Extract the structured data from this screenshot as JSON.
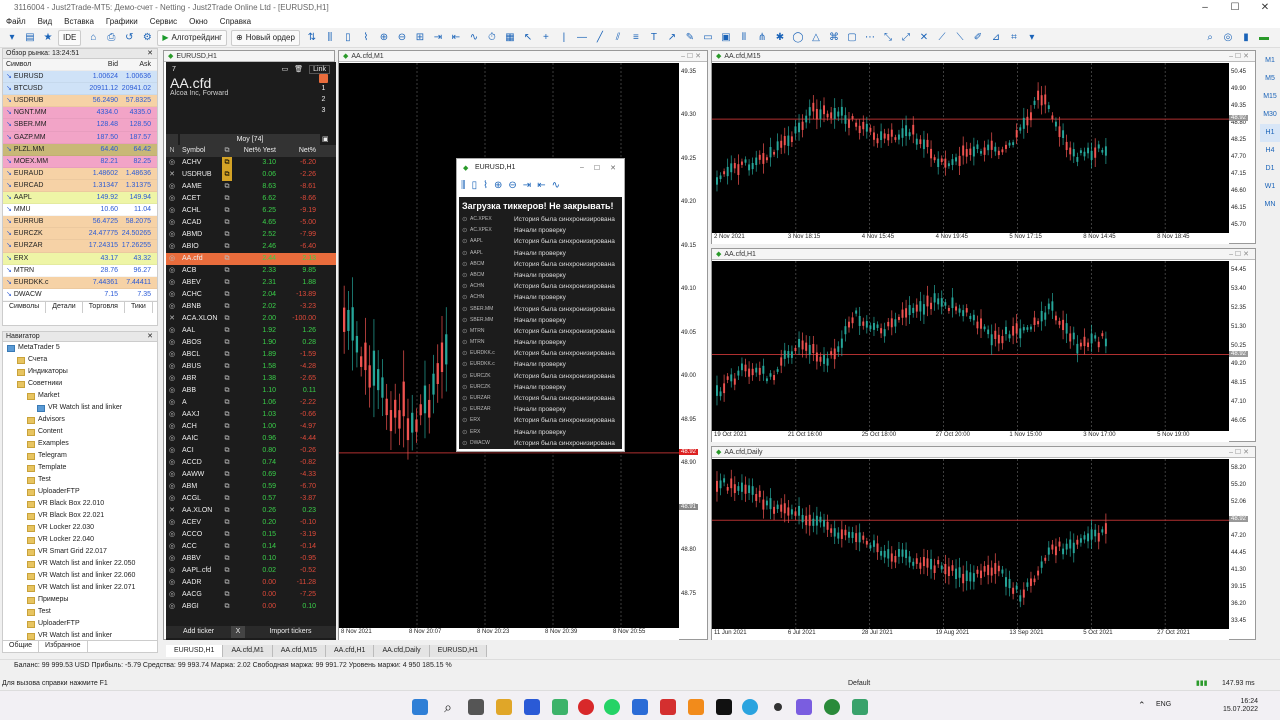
{
  "window": {
    "title": "3116004 - Just2Trade-MT5: Демо-счет - Netting - Just2Trade Online Ltd - [EURUSD,H1]"
  },
  "menu": [
    "Файл",
    "Вид",
    "Вставка",
    "Графики",
    "Сервис",
    "Окно",
    "Справка"
  ],
  "toolbar": {
    "algo": "Алготрейдинг",
    "new_order": "Новый ордер",
    "ide": "IDE"
  },
  "market_watch": {
    "title": "Обзор рынка: 13:24:51",
    "col_symbol": "Символ",
    "col_bid": "Bid",
    "col_ask": "Ask",
    "rows": [
      {
        "s": "EURUSD",
        "b": "1.00624",
        "a": "1.00636",
        "bg": "#cfe2f7"
      },
      {
        "s": "BTCUSD",
        "b": "20911.12",
        "a": "20941.02",
        "bg": "#cfe2f7"
      },
      {
        "s": "USDRUB",
        "b": "56.2490",
        "a": "57.8325",
        "bg": "#f6d2a6"
      },
      {
        "s": "NGNT.MM",
        "b": "4334.0",
        "a": "4335.0",
        "bg": "#f2a4c7"
      },
      {
        "s": "SBER.MM",
        "b": "128.48",
        "a": "128.50",
        "bg": "#f2a4c7"
      },
      {
        "s": "GAZP.MM",
        "b": "187.50",
        "a": "187.57",
        "bg": "#f2a4c7"
      },
      {
        "s": "PLZL.MM",
        "b": "64.40",
        "a": "64.42",
        "bg": "#c8b877"
      },
      {
        "s": "MOEX.MM",
        "b": "82.21",
        "a": "82.25",
        "bg": "#f2a4c7"
      },
      {
        "s": "EURAUD",
        "b": "1.48602",
        "a": "1.48636",
        "bg": "#f6d2a6"
      },
      {
        "s": "EURCAD",
        "b": "1.31347",
        "a": "1.31375",
        "bg": "#f6d2a6"
      },
      {
        "s": "AAPL",
        "b": "149.92",
        "a": "149.94",
        "bg": "#eef5a6"
      },
      {
        "s": "MMU",
        "b": "10.60",
        "a": "11.04",
        "bg": "#ffffff"
      },
      {
        "s": "EURRUB",
        "b": "56.4725",
        "a": "58.2075",
        "bg": "#f6d2a6"
      },
      {
        "s": "EURCZK",
        "b": "24.47775",
        "a": "24.50265",
        "bg": "#f6d2a6"
      },
      {
        "s": "EURZAR",
        "b": "17.24315",
        "a": "17.26255",
        "bg": "#f6d2a6"
      },
      {
        "s": "ERX",
        "b": "43.17",
        "a": "43.32",
        "bg": "#eef5a6"
      },
      {
        "s": "MTRN",
        "b": "28.76",
        "a": "96.27",
        "bg": "#ffffff"
      },
      {
        "s": "EURDKK.c",
        "b": "7.44361",
        "a": "7.44411",
        "bg": "#f6d2a6"
      },
      {
        "s": "DWACW",
        "b": "7.15",
        "a": "7.35",
        "bg": "#ffffff"
      }
    ],
    "tabs": [
      "Символы",
      "Детали",
      "Торговля",
      "Тики"
    ]
  },
  "navigator": {
    "title": "Навигатор",
    "items": [
      {
        "t": "MetaTrader 5",
        "l": 0
      },
      {
        "t": "Счета",
        "l": 1
      },
      {
        "t": "Индикаторы",
        "l": 1
      },
      {
        "t": "Советники",
        "l": 1
      },
      {
        "t": "Market",
        "l": 2
      },
      {
        "t": "VR Watch list and linker",
        "l": 3
      },
      {
        "t": "Advisors",
        "l": 2
      },
      {
        "t": "Content",
        "l": 2
      },
      {
        "t": "Examples",
        "l": 2
      },
      {
        "t": "Telegram",
        "l": 2
      },
      {
        "t": "Template",
        "l": 2
      },
      {
        "t": "Test",
        "l": 2
      },
      {
        "t": "UploaderFTP",
        "l": 2
      },
      {
        "t": "VR Black Box 22.010",
        "l": 2
      },
      {
        "t": "VR Black Box 22.021",
        "l": 2
      },
      {
        "t": "VR Locker 22.030",
        "l": 2
      },
      {
        "t": "VR Locker 22.040",
        "l": 2
      },
      {
        "t": "VR Smart Grid 22.017",
        "l": 2
      },
      {
        "t": "VR Watch list and linker 22.050",
        "l": 2
      },
      {
        "t": "VR Watch list and linker 22.060",
        "l": 2
      },
      {
        "t": "VR Watch list and linker 22.071",
        "l": 2
      },
      {
        "t": "Примеры",
        "l": 2
      },
      {
        "t": "Test",
        "l": 2
      },
      {
        "t": "UploaderFTP",
        "l": 2
      },
      {
        "t": "VR Watch list and linker",
        "l": 2
      }
    ],
    "tabs": [
      "Общие",
      "Избранное"
    ]
  },
  "eurusd_window": {
    "title": "EURUSD,H1"
  },
  "watchlist": {
    "num": "7",
    "symbol": "AA.cfd",
    "company": "Alcoa Inc, Forward",
    "link": "Link",
    "group": "Moy [74]",
    "col_symbol": "Symbol",
    "col_yest": "Net% Yest",
    "col_net": "Net%",
    "n_label": "N",
    "list_numbers": [
      "1",
      "2",
      "3"
    ],
    "rows": [
      {
        "s": "ACHV",
        "y": "3.10",
        "n": "-6.20"
      },
      {
        "s": "USDRUB",
        "y": "0.06",
        "n": "-2.26"
      },
      {
        "s": "AAME",
        "y": "8.63",
        "n": "-8.61"
      },
      {
        "s": "ACET",
        "y": "6.62",
        "n": "-8.66"
      },
      {
        "s": "ACHL",
        "y": "6.25",
        "n": "-9.19"
      },
      {
        "s": "ACAD",
        "y": "4.65",
        "n": "-5.00"
      },
      {
        "s": "ABMD",
        "y": "2.52",
        "n": "-7.99"
      },
      {
        "s": "ABIO",
        "y": "2.46",
        "n": "-6.40"
      },
      {
        "s": "AA.cfd",
        "y": "2.44",
        "n": "2.13",
        "sel": true
      },
      {
        "s": "ACB",
        "y": "2.33",
        "n": "9.85"
      },
      {
        "s": "ABEV",
        "y": "2.31",
        "n": "1.88"
      },
      {
        "s": "ACHC",
        "y": "2.04",
        "n": "-13.89"
      },
      {
        "s": "ABNB",
        "y": "2.02",
        "n": "-3.23"
      },
      {
        "s": "ACA.XLON",
        "y": "2.00",
        "n": "-100.00"
      },
      {
        "s": "AAL",
        "y": "1.92",
        "n": "1.26"
      },
      {
        "s": "ABOS",
        "y": "1.90",
        "n": "0.28"
      },
      {
        "s": "ABCL",
        "y": "1.89",
        "n": "-1.59"
      },
      {
        "s": "ABUS",
        "y": "1.58",
        "n": "-4.28"
      },
      {
        "s": "ABR",
        "y": "1.38",
        "n": "-2.65"
      },
      {
        "s": "ABB",
        "y": "1.10",
        "n": "0.11"
      },
      {
        "s": "A",
        "y": "1.06",
        "n": "-2.22"
      },
      {
        "s": "AAXJ",
        "y": "1.03",
        "n": "-0.66"
      },
      {
        "s": "ACH",
        "y": "1.00",
        "n": "-4.97"
      },
      {
        "s": "AAIC",
        "y": "0.96",
        "n": "-4.44"
      },
      {
        "s": "ACI",
        "y": "0.80",
        "n": "-0.26"
      },
      {
        "s": "ACCD",
        "y": "0.74",
        "n": "-0.82"
      },
      {
        "s": "AAWW",
        "y": "0.69",
        "n": "-4.33"
      },
      {
        "s": "ABM",
        "y": "0.59",
        "n": "-6.70"
      },
      {
        "s": "ACGL",
        "y": "0.57",
        "n": "-3.87"
      },
      {
        "s": "AA.XLON",
        "y": "0.26",
        "n": "0.23"
      },
      {
        "s": "ACEV",
        "y": "0.20",
        "n": "-0.10"
      },
      {
        "s": "ACCO",
        "y": "0.15",
        "n": "-3.19"
      },
      {
        "s": "ACC",
        "y": "0.14",
        "n": "-0.14"
      },
      {
        "s": "ABBV",
        "y": "0.10",
        "n": "-0.95"
      },
      {
        "s": "AAPL.cfd",
        "y": "0.02",
        "n": "-0.52"
      },
      {
        "s": "AADR",
        "y": "0.00",
        "n": "-11.28"
      },
      {
        "s": "AACG",
        "y": "0.00",
        "n": "-7.25"
      },
      {
        "s": "ABGI",
        "y": "0.00",
        "n": "0.10"
      }
    ],
    "add_btn": "Add ticker",
    "x_btn": "X",
    "import_btn": "Import tickers"
  },
  "charts": [
    {
      "title": "AA.cfd,M1",
      "prices": [
        "49.35",
        "49.30",
        "49.25",
        "49.20",
        "49.15",
        "49.10",
        "49.05",
        "49.00",
        "48.95",
        "48.90",
        "48.85",
        "48.80",
        "48.75"
      ],
      "times": [
        "8 Nov 2021",
        "8 Nov 20:07",
        "8 Nov 20:23",
        "8 Nov 20:39",
        "8 Nov 20:55"
      ],
      "cur": "48.92",
      "bid": "48.91"
    },
    {
      "title": "AA.cfd,M15",
      "prices": [
        "50.45",
        "49.90",
        "49.35",
        "48.80",
        "48.25",
        "47.70",
        "47.15",
        "46.60",
        "46.15",
        "45.70"
      ],
      "times": [
        "2 Nov 2021",
        "3 Nov 18:15",
        "4 Nov 15:45",
        "4 Nov 19:45",
        "5 Nov 17:15",
        "8 Nov 14:45",
        "8 Nov 18:45"
      ],
      "cur": "48.92"
    },
    {
      "title": "AA.cfd,H1",
      "prices": [
        "54.45",
        "53.40",
        "52.35",
        "51.30",
        "50.25",
        "49.20",
        "48.15",
        "47.10",
        "46.05"
      ],
      "times": [
        "19 Oct 2021",
        "21 Oct 16:00",
        "25 Oct 18:00",
        "27 Oct 20:00",
        "1 Nov 15:00",
        "3 Nov 17:00",
        "5 Nov 19:00"
      ],
      "cur": "48.92"
    },
    {
      "title": "AA.cfd,Daily",
      "prices": [
        "58.20",
        "55.20",
        "52.06",
        "49.28",
        "47.20",
        "44.45",
        "41.30",
        "39.15",
        "36.20",
        "33.45"
      ],
      "times": [
        "11 Jun 2021",
        "6 Jul 2021",
        "28 Jul 2021",
        "19 Aug 2021",
        "13 Sep 2021",
        "5 Oct 2021",
        "27 Oct 2021"
      ],
      "cur": "48.92"
    }
  ],
  "timeframes": [
    "M1",
    "M5",
    "M15",
    "M30",
    "H1",
    "H4",
    "D1",
    "W1",
    "MN"
  ],
  "popup": {
    "title": "EURUSD,H1",
    "heading": "Загрузка тиккеров! Не закрывать!",
    "rows": [
      {
        "t": "AC.XPEX",
        "m": "История была синхронизирована"
      },
      {
        "t": "AC.XPEX",
        "m": "Начали проверку"
      },
      {
        "t": "AAPL",
        "m": "История была синхронизирована"
      },
      {
        "t": "AAPL",
        "m": "Начали проверку"
      },
      {
        "t": "ABCM",
        "m": "История была синхронизирована"
      },
      {
        "t": "ABCM",
        "m": "Начали проверку"
      },
      {
        "t": "ACHN",
        "m": "История была синхронизирована"
      },
      {
        "t": "ACHN",
        "m": "Начали проверку"
      },
      {
        "t": "SBER.MM",
        "m": "История была синхронизирована"
      },
      {
        "t": "SBER.MM",
        "m": "Начали проверку"
      },
      {
        "t": "MTRN",
        "m": "История была синхронизирована"
      },
      {
        "t": "MTRN",
        "m": "Начали проверку"
      },
      {
        "t": "EURDKK.c",
        "m": "История была синхронизирована"
      },
      {
        "t": "EURDKK.c",
        "m": "Начали проверку"
      },
      {
        "t": "EURCZK",
        "m": "История была синхронизирована"
      },
      {
        "t": "EURCZK",
        "m": "Начали проверку"
      },
      {
        "t": "EURZAR",
        "m": "История была синхронизирована"
      },
      {
        "t": "EURZAR",
        "m": "Начали проверку"
      },
      {
        "t": "ERX",
        "m": "История была синхронизирована"
      },
      {
        "t": "ERX",
        "m": "Начали проверку"
      },
      {
        "t": "DWACW",
        "m": "История была синхронизирована"
      }
    ]
  },
  "chart_tabs": [
    "EURUSD,H1",
    "AA.cfd,M1",
    "AA.cfd,M15",
    "AA.cfd,H1",
    "AA.cfd,Daily",
    "EURUSD,H1"
  ],
  "status": {
    "balance": "Баланс: 99 999.53 USD  Прибыль: -5.79  Средства: 99 993.74  Маржа: 2.02  Свободная маржа: 99 991.72  Уровень маржи: 4 950 185.15 %",
    "help": "Для вызова справки нажмите F1",
    "profile": "Default",
    "ping": "147.93 ms"
  },
  "taskbar": {
    "lang": "ENG",
    "time": "16:24",
    "date": "15.07.2022"
  },
  "colors": {
    "bull": "#26a69a",
    "bear": "#ef5350",
    "line": "#b03030",
    "sel": "#e96c3c"
  }
}
